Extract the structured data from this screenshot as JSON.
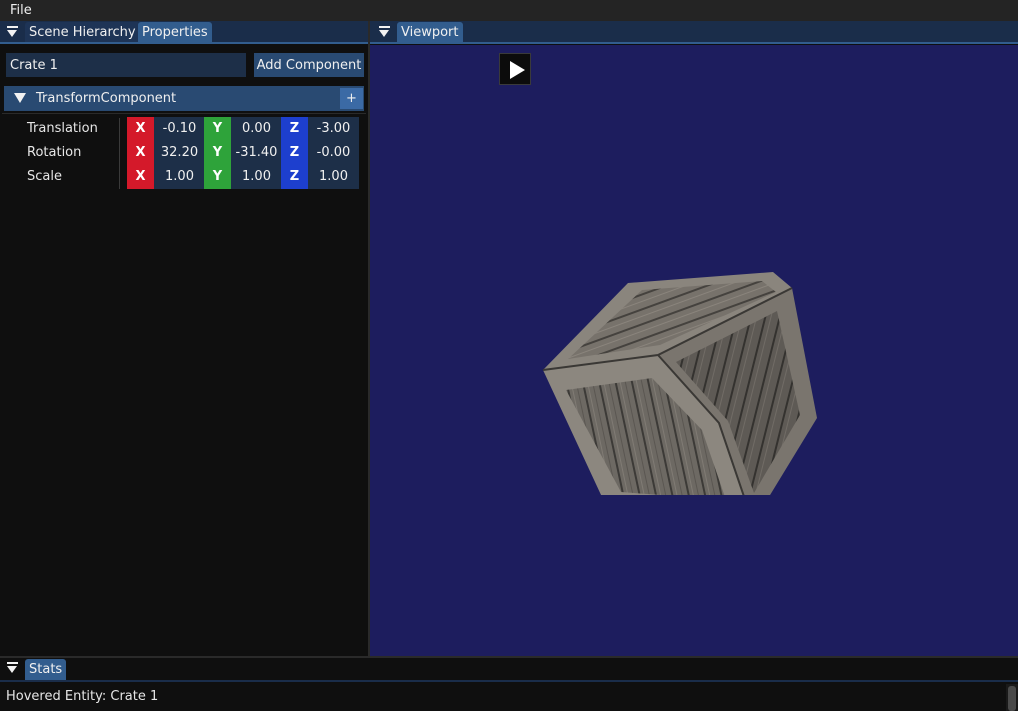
{
  "menu": {
    "file": "File"
  },
  "left_tabs": {
    "scene_hierarchy": "Scene Hierarchy",
    "properties": "Properties"
  },
  "viewport_tab": {
    "label": "Viewport"
  },
  "properties": {
    "entity_name": "Crate 1",
    "add_component_label": "Add Component",
    "component": {
      "title": "TransformComponent",
      "add_label": "+",
      "rows": [
        {
          "label": "Translation",
          "x": "-0.10",
          "y": "0.00",
          "z": "-3.00"
        },
        {
          "label": "Rotation",
          "x": "32.20",
          "y": "-31.40",
          "z": "-0.00"
        },
        {
          "label": "Scale",
          "x": "1.00",
          "y": "1.00",
          "z": "1.00"
        }
      ],
      "axis_labels": {
        "x": "X",
        "y": "Y",
        "z": "Z"
      }
    }
  },
  "stats": {
    "tab": "Stats",
    "hovered": "Hovered Entity: Crate 1"
  },
  "icons": {
    "play": "play-icon",
    "collapse": "collapse-triangle-icon"
  },
  "colors": {
    "axis_x": "#d4192a",
    "axis_y": "#2ea33a",
    "axis_z": "#1d3fce",
    "viewport_bg": "#1d1d5e",
    "tab_active": "#325d8e"
  }
}
